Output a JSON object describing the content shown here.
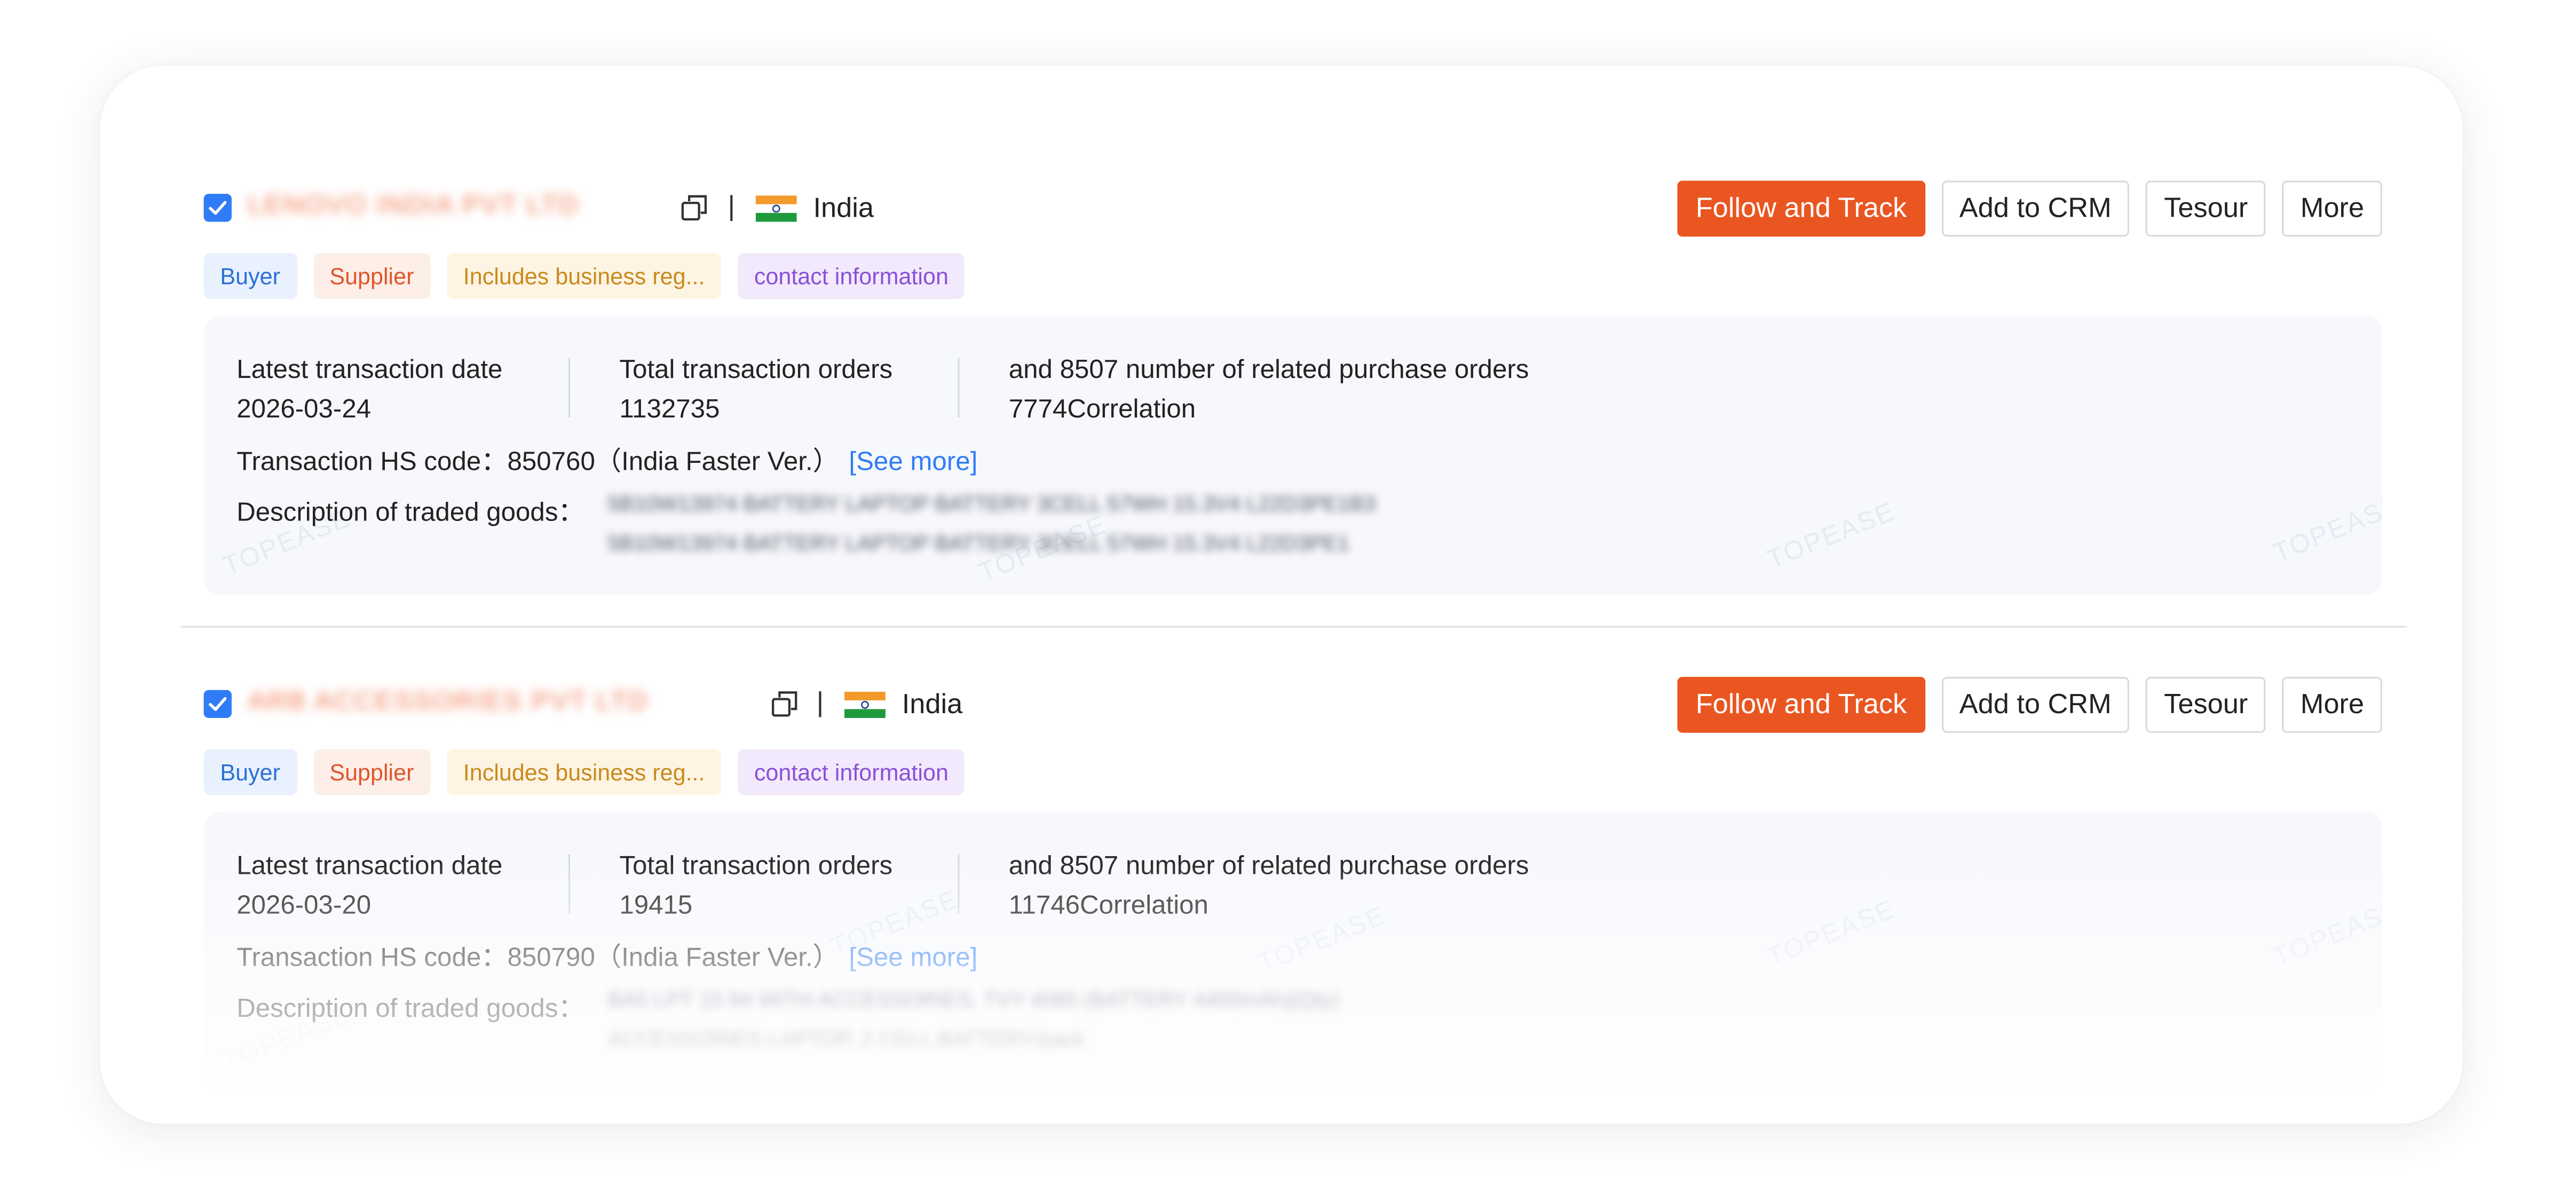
{
  "records": [
    {
      "company_name": "LENOVO INDIA PVT LTD",
      "separator": "|",
      "country": "India",
      "actions": {
        "follow_label": "Follow and Track",
        "crm_label": "Add to CRM",
        "tesour_label": "Tesour",
        "more_label": "More"
      },
      "tags": {
        "buyer": "Buyer",
        "supplier": "Supplier",
        "business": "Includes business reg...",
        "contact": "contact information"
      },
      "stats": {
        "latest_label": "Latest transaction date",
        "latest_value": "2026-03-24",
        "orders_label": "Total transaction orders",
        "orders_value": "1132735",
        "related_label": "and 8507 number of related purchase orders",
        "related_value": "7774Correlation"
      },
      "hs": {
        "label": "Transaction HS code：",
        "code": "850760",
        "version": "（India Faster Ver.）",
        "see_more": "[See more]"
      },
      "description": {
        "label": "Description of traded goods：",
        "line1": "5B10W13974 BATTERY LAPTOP BATTERY 3CELL 57WH 15.3V4 L22D3PE1B3",
        "line2": "5B10W13974 BATTERY LAPTOP BATTERY 3CELL 57WH 15.3V4 L22D3PE1"
      }
    },
    {
      "company_name": "ARB ACCESSORIES PVT LTD",
      "separator": "|",
      "country": "India",
      "actions": {
        "follow_label": "Follow and Track",
        "crm_label": "Add to CRM",
        "tesour_label": "Tesour",
        "more_label": "More"
      },
      "tags": {
        "buyer": "Buyer",
        "supplier": "Supplier",
        "business": "Includes business reg...",
        "contact": "contact information"
      },
      "stats": {
        "latest_label": "Latest transaction date",
        "latest_value": "2026-03-20",
        "orders_label": "Total transaction orders",
        "orders_value": "19415",
        "related_label": "and 8507 number of related purchase orders",
        "related_value": "11746Correlation"
      },
      "hs": {
        "label": "Transaction HS code：",
        "code": "850790",
        "version": "（India Faster Ver.）",
        "see_more": "[See more]"
      },
      "description": {
        "label": "Description of traded goods：",
        "line1": "BA5 LPT 10 94 WITH ACCESSORIES, TVY 4060 (BATTERY 4400mAh)(Qty)",
        "line2": "ACCESSORIES LAPTOP, 2 CELL BATTERY/pack"
      }
    }
  ],
  "watermark": "TOPEASE",
  "colors": {
    "accent": "#ea5621",
    "link": "#2f7cf6",
    "checkbox": "#2f7cf6",
    "panel_bg": "#f6f8fc"
  },
  "icons": {
    "checkbox": "checkbox-checked-icon",
    "copy": "copy-icon",
    "flag": "india-flag-icon"
  }
}
